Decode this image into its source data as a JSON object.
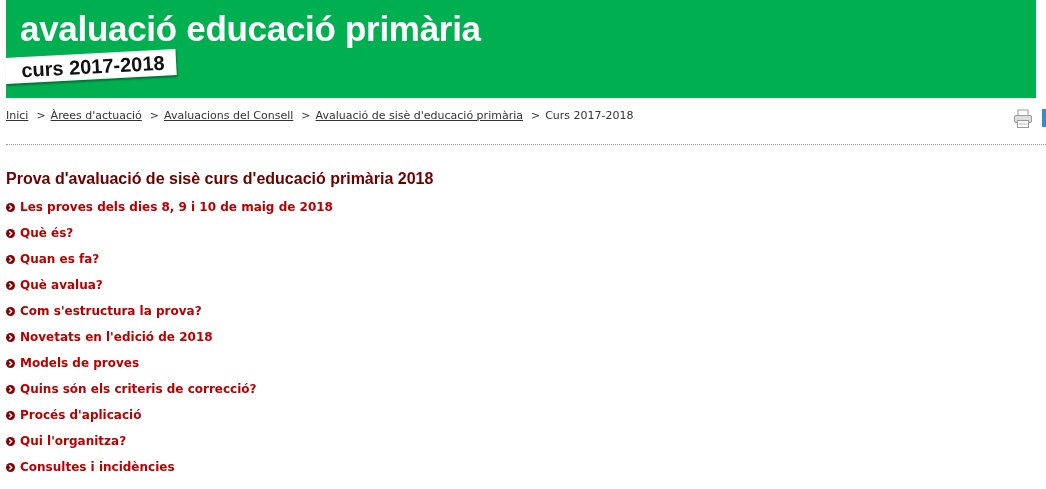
{
  "banner": {
    "title": "avaluació educació primària",
    "tag": "curs 2017-2018"
  },
  "breadcrumb": [
    {
      "label": "Inici",
      "link": true
    },
    {
      "label": "Àrees d'actuació",
      "link": true
    },
    {
      "label": "Avaluacions del Consell",
      "link": true
    },
    {
      "label": "Avaluació de sisè d'educació primària",
      "link": true
    },
    {
      "label": "Curs 2017-2018",
      "link": false
    }
  ],
  "breadcrumb_separator": ">",
  "heading": "Prova d'avaluació de sisè curs d'educació primària 2018",
  "links": [
    "Les proves dels dies 8, 9 i 10 de maig de 2018",
    "Què és?",
    "Quan es fa?",
    "Què avalua?",
    "Com s'estructura la prova?",
    "Novetats en l'edició de 2018",
    "Models de proves",
    "Quins són els criteris de correcció?",
    "Procés d'aplicació",
    "Qui l'organitza?",
    "Consultes i incidències"
  ]
}
